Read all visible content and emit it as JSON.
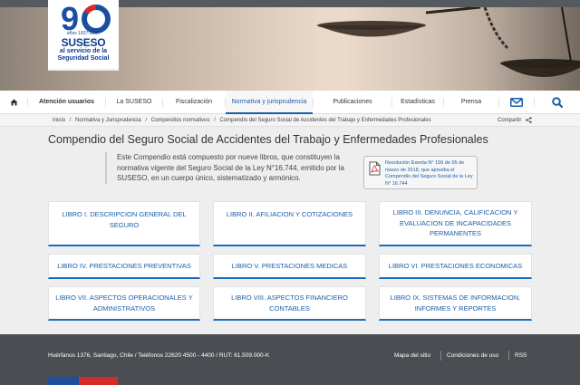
{
  "logo": {
    "number": "90",
    "years_word": "años",
    "years_range": "1927-2017",
    "name": "SUSESO",
    "tagline_line1": "al servicio de la",
    "tagline_line2": "Seguridad Social"
  },
  "nav": {
    "items": [
      {
        "label": "Atención usuarios"
      },
      {
        "label": "La SUSESO"
      },
      {
        "label": "Fiscalización"
      },
      {
        "label": "Normativa y jurisprudencia"
      },
      {
        "label": "Publicaciones"
      },
      {
        "label": "Estadísticas"
      },
      {
        "label": "Prensa"
      }
    ]
  },
  "breadcrumb": {
    "items": [
      "Inicio",
      "Normativa y Jurisprudencia",
      "Compendios normativos",
      "Compendio del Seguro Social de Accidentes del Trabajo y Enfermedades Profesionales"
    ],
    "separator": "/",
    "share_label": "Compartir"
  },
  "main": {
    "title": "Compendio del Seguro Social de Accidentes del Trabajo y Enfermedades Profesionales",
    "intro": "Este Compendio está compuesto por nueve libros, que constituyen la normativa vigente del Seguro Social de la Ley N°16.744, emitido por la SUSESO, en un cuerpo único, sistematizado y armónico.",
    "resolution_link": "Resolución Exenta N° 156 de 05 de marzo de 2018, que aprueba el Compendio del Seguro Social de la Ley N° 16.744",
    "books": [
      {
        "line1": "LIBRO I. DESCRIPCION GENERAL DEL SEGURO",
        "line2": "",
        "line3": ""
      },
      {
        "line1": "LIBRO II. AFILIACION Y COTIZACIONES",
        "line2": "",
        "line3": ""
      },
      {
        "line1": "LIBRO III. DENUNCIA, CALIFICACION Y",
        "line2": "EVALUACION DE INCAPACIDADES",
        "line3": "PERMANENTES"
      },
      {
        "line1": "LIBRO IV. PRESTACIONES PREVENTIVAS",
        "line2": "",
        "line3": ""
      },
      {
        "line1": "LIBRO V. PRESTACIONES MEDICAS",
        "line2": "",
        "line3": ""
      },
      {
        "line1": "LIBRO VI. PRESTACIONES ECONOMICAS",
        "line2": "",
        "line3": ""
      },
      {
        "line1": "LIBRO VII. ASPECTOS OPERACIONALES Y",
        "line2": "ADMINISTRATIVOS",
        "line3": ""
      },
      {
        "line1": "LIBRO VIII. ASPECTOS FINANCIERO",
        "line2": "CONTABLES",
        "line3": ""
      },
      {
        "line1": "LIBRO IX. SISTEMAS DE INFORMACION.",
        "line2": "INFORMES Y REPORTES",
        "line3": ""
      }
    ]
  },
  "footer": {
    "address": "Huérfanos 1376, Santiago, Chile / Teléfonos 22620 4500 - 4400 / RUT: 61.509.000-K",
    "links": [
      {
        "label": "Mapa del sitio"
      },
      {
        "label": "Condiciones de uso"
      },
      {
        "label": "RSS"
      }
    ]
  },
  "icons": {
    "home": "home-icon",
    "mail": "mail-icon",
    "search": "search-icon",
    "share": "share-icon",
    "pdf": "pdf-icon"
  },
  "colors": {
    "brand_blue": "#0a3c8c",
    "link_blue": "#1a5ea8",
    "active_nav": "#1a5ea8",
    "footer_bg": "#4a4e52",
    "flag_red": "#d42b2b"
  }
}
